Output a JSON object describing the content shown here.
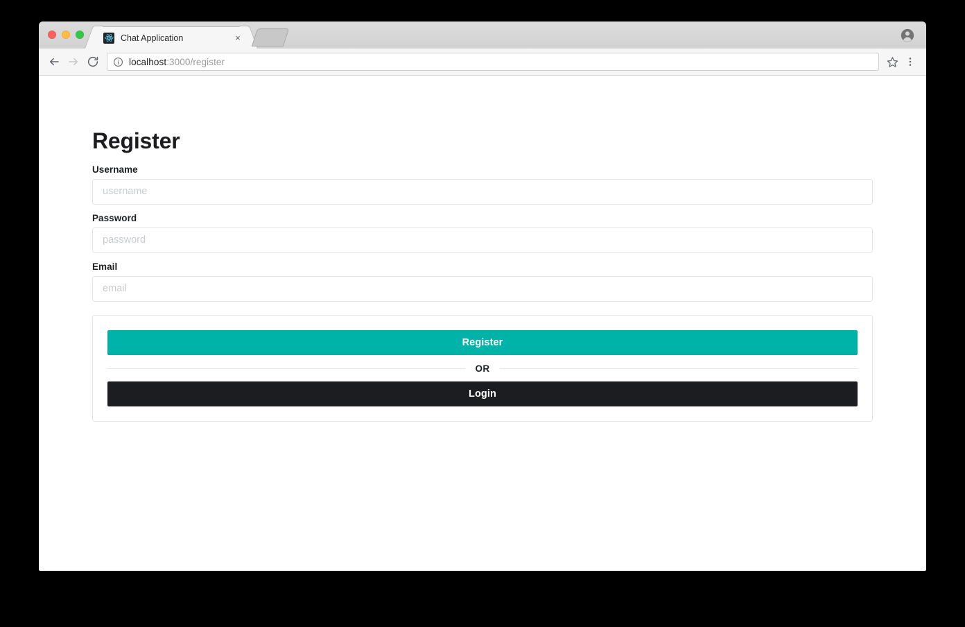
{
  "browser": {
    "tab": {
      "title": "Chat Application",
      "favicon_name": "react-logo-icon",
      "close_label": "×"
    },
    "new_tab_label": "",
    "toolbar": {
      "back_icon": "back-arrow-icon",
      "forward_icon": "forward-arrow-icon",
      "reload_icon": "reload-icon",
      "info_icon": "info-circle-icon",
      "url_host": "localhost",
      "url_path": ":3000/register",
      "bookmark_icon": "star-icon",
      "menu_icon": "three-dot-menu-icon",
      "profile_icon": "account-avatar-icon"
    }
  },
  "page": {
    "heading": "Register",
    "fields": [
      {
        "label": "Username",
        "placeholder": "username",
        "value": "",
        "type": "text",
        "name": "username"
      },
      {
        "label": "Password",
        "placeholder": "password",
        "value": "",
        "type": "password",
        "name": "password"
      },
      {
        "label": "Email",
        "placeholder": "email",
        "value": "",
        "type": "text",
        "name": "email"
      }
    ],
    "actions": {
      "primary_label": "Register",
      "divider_label": "OR",
      "secondary_label": "Login"
    }
  },
  "colors": {
    "accent_teal": "#00b3a9",
    "dark_button": "#1b1d20",
    "text": "#1d1f21",
    "placeholder": "#c8cbd0",
    "border": "#e3e5e8",
    "page_bg": "#ffffff",
    "chrome_tabstrip": "#d6d6d6",
    "chrome_toolbar": "#f6f6f6"
  }
}
